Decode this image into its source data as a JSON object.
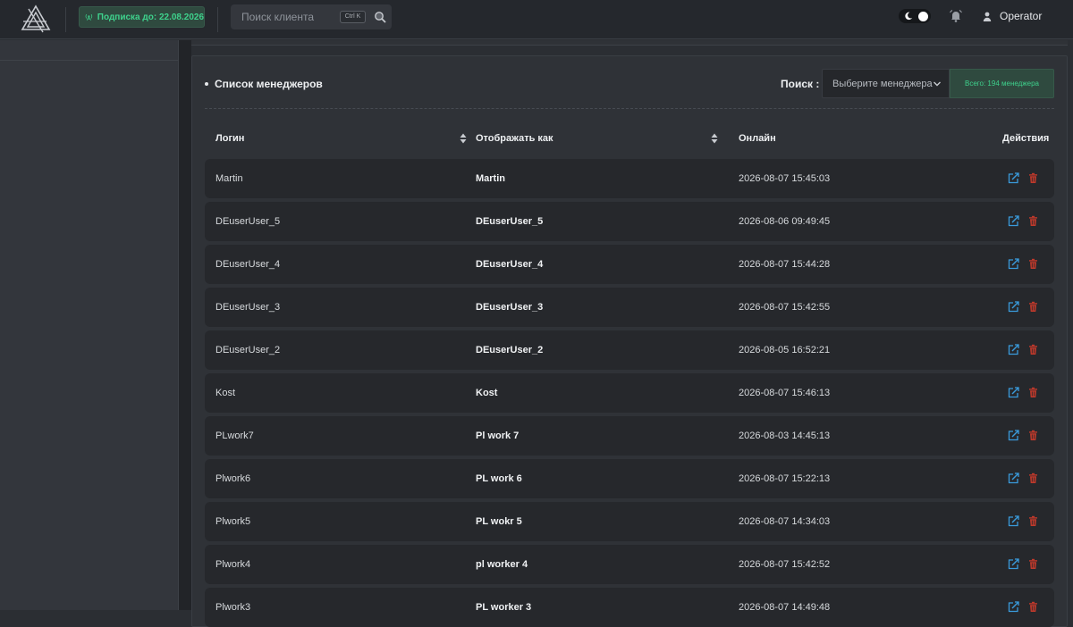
{
  "header": {
    "subscription_label": "Подписка до: 22.08.2026",
    "search_placeholder": "Поиск клиента",
    "search_shortcut": "Ctrl K",
    "user_name": "Operator",
    "icons": [
      "logo-icon",
      "antenna-icon",
      "search-icon",
      "moon-icon",
      "bell-icon",
      "user-icon"
    ]
  },
  "panel": {
    "title": "Список менеджеров",
    "search_label": "Поиск :",
    "select_placeholder": "Выберите менеджера",
    "total_label": "Всего: 194 менеджера"
  },
  "table": {
    "columns": [
      "Логин",
      "Отображать как",
      "Онлайн",
      "Действия"
    ],
    "rows": [
      {
        "login": "Martin",
        "display": "Martin",
        "online": "2026-08-07 15:45:03"
      },
      {
        "login": "DEuserUser_5",
        "display": "DEuserUser_5",
        "online": "2026-08-06 09:49:45"
      },
      {
        "login": "DEuserUser_4",
        "display": "DEuserUser_4",
        "online": "2026-08-07 15:44:28"
      },
      {
        "login": "DEuserUser_3",
        "display": "DEuserUser_3",
        "online": "2026-08-07 15:42:55"
      },
      {
        "login": "DEuserUser_2",
        "display": "DEuserUser_2",
        "online": "2026-08-05 16:52:21"
      },
      {
        "login": "Kost",
        "display": "Kost",
        "online": "2026-08-07 15:46:13"
      },
      {
        "login": "PLwork7",
        "display": "Pl work 7",
        "online": "2026-08-03 14:45:13"
      },
      {
        "login": "Plwork6",
        "display": "PL work 6",
        "online": "2026-08-07 15:22:13"
      },
      {
        "login": "Plwork5",
        "display": "PL wokr 5",
        "online": "2026-08-07 14:34:03"
      },
      {
        "login": "Plwork4",
        "display": "pl worker 4",
        "online": "2026-08-07 15:42:52"
      },
      {
        "login": "Plwork3",
        "display": "PL worker 3",
        "online": "2026-08-07 14:49:48"
      }
    ]
  },
  "colors": {
    "accent_green": "#3ed18c",
    "edit_blue": "#3a9bdc",
    "delete_red": "#c0392b"
  }
}
